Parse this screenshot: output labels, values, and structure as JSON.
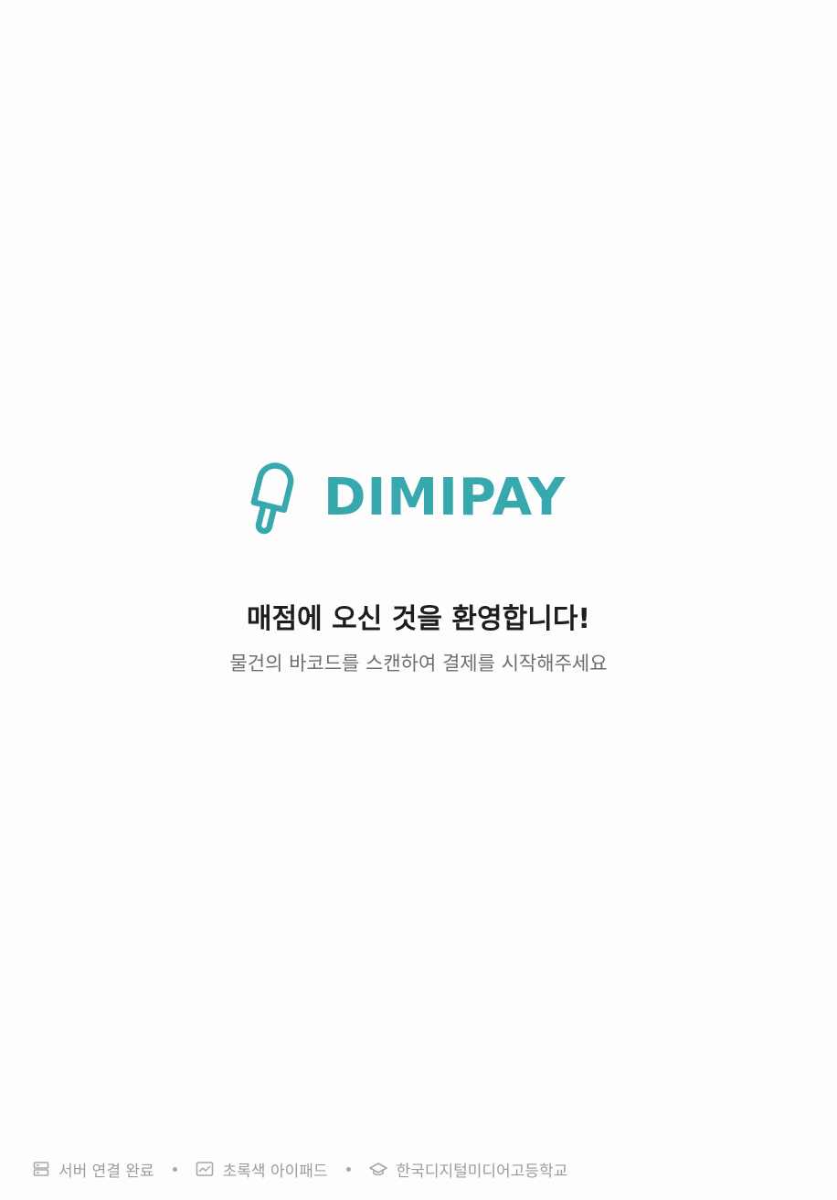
{
  "brand": {
    "name": "DIMIPAY",
    "color": "#36a8ae",
    "icon": "popsicle-icon"
  },
  "main": {
    "welcome": "매점에 오신 것을 환영합니다!",
    "instruction": "물건의 바코드를 스캔하여 결제를 시작해주세요"
  },
  "status": {
    "server": {
      "icon": "server-icon",
      "label": "서버 연결 완료"
    },
    "device": {
      "icon": "tablet-icon",
      "label": "초록색 아이패드"
    },
    "school": {
      "icon": "graduation-cap-icon",
      "label": "한국디지털미디어고등학교"
    },
    "text_color": "#9c9c9c"
  }
}
